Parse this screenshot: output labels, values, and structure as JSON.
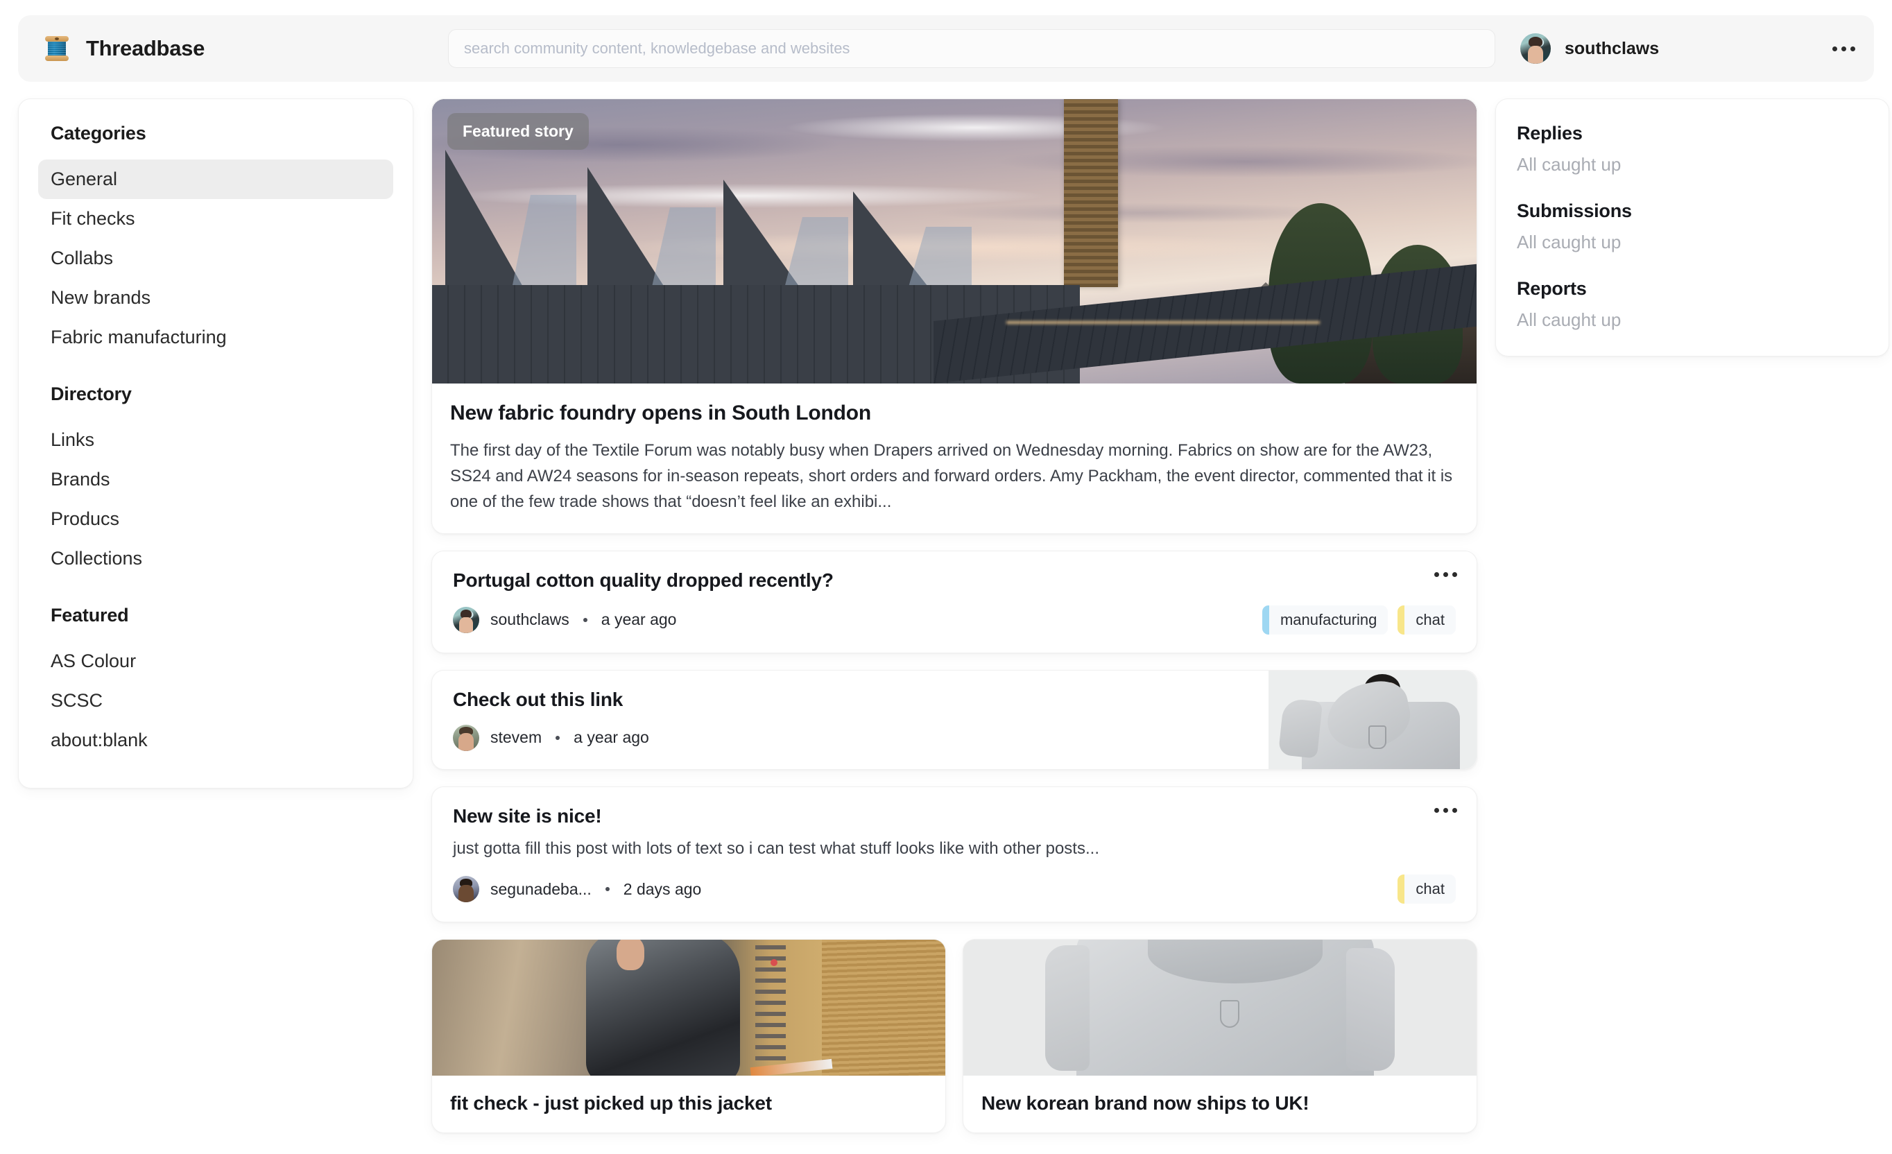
{
  "header": {
    "logo_icon": "thread-spool-icon",
    "brand": "Threadbase",
    "search": {
      "placeholder": "search community content, knowledgebase and websites",
      "value": ""
    },
    "user": {
      "name": "southclaws",
      "avatar": "user-photo-southclaws"
    },
    "more_icon": "ellipsis-icon"
  },
  "sidebar": {
    "groups": [
      {
        "heading": "Categories",
        "items": [
          {
            "label": "General",
            "active": true
          },
          {
            "label": "Fit checks",
            "active": false
          },
          {
            "label": "Collabs",
            "active": false
          },
          {
            "label": "New brands",
            "active": false
          },
          {
            "label": "Fabric manufacturing",
            "active": false
          }
        ]
      },
      {
        "heading": "Directory",
        "items": [
          {
            "label": "Links",
            "active": false
          },
          {
            "label": "Brands",
            "active": false
          },
          {
            "label": "Producs",
            "active": false
          },
          {
            "label": "Collections",
            "active": false
          }
        ]
      },
      {
        "heading": "Featured",
        "items": [
          {
            "label": "AS Colour",
            "active": false
          },
          {
            "label": "SCSC",
            "active": false
          },
          {
            "label": "about:blank",
            "active": false
          }
        ]
      }
    ]
  },
  "feed": {
    "featured": {
      "badge": "Featured story",
      "image_alt": "sawtooth-roof-factory-at-dusk",
      "title": "New fabric foundry opens in South London",
      "excerpt": "The first day of the Textile Forum was notably busy when Drapers arrived on Wednesday morning. Fabrics on show are for the AW23, SS24 and AW24 seasons for in-season repeats, short orders and forward orders. Amy Packham, the event director, commented that it is one of the few trade shows that “doesn’t feel like an exhibi..."
    },
    "posts": [
      {
        "title": "Portugal cotton quality dropped recently?",
        "author": "southclaws",
        "time": "a year ago",
        "separator": "•",
        "has_more": true,
        "tags": [
          {
            "label": "manufacturing",
            "color": "#9ed7f2"
          },
          {
            "label": "chat",
            "color": "#f8e68a"
          }
        ]
      },
      {
        "title": "Check out this link",
        "author": "stevem",
        "time": "a year ago",
        "separator": "•",
        "has_more": false,
        "thumbnail": "grey-hoodie-model",
        "tags": []
      },
      {
        "title": "New site is nice!",
        "excerpt": "just gotta fill this post with lots of text so i can test what stuff looks like with other posts...",
        "author": "segunadeba...",
        "time": "2 days ago",
        "separator": "•",
        "has_more": true,
        "tags": [
          {
            "label": "chat",
            "color": "#f8e68a"
          }
        ]
      }
    ],
    "image_cards": [
      {
        "title": "fit check - just picked up this jacket",
        "image_alt": "person-in-jacket-in-elevator"
      },
      {
        "title": "New korean brand now ships to UK!",
        "image_alt": "grey-hoodie-product-shot"
      }
    ]
  },
  "right_panel": {
    "blocks": [
      {
        "heading": "Replies",
        "status": "All caught up"
      },
      {
        "heading": "Submissions",
        "status": "All caught up"
      },
      {
        "heading": "Reports",
        "status": "All caught up"
      }
    ]
  }
}
